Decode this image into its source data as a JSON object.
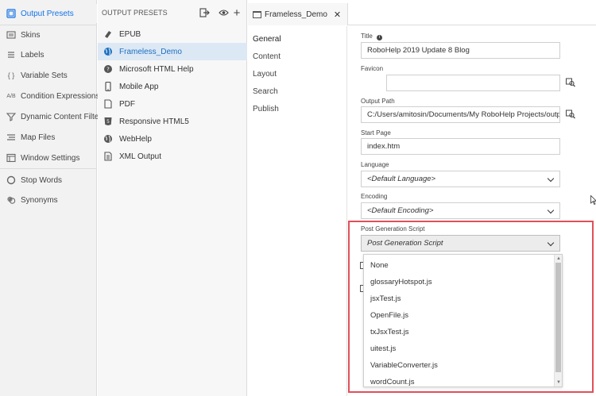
{
  "left_nav": {
    "items": [
      {
        "label": "Output Presets",
        "icon": "output-presets-icon",
        "active": true
      },
      {
        "label": "Skins",
        "icon": "skins-icon"
      },
      {
        "label": "Labels",
        "icon": "labels-icon"
      },
      {
        "label": "Variable Sets",
        "icon": "variable-sets-icon",
        "glyph": "{ }"
      },
      {
        "label": "Condition Expressions",
        "icon": "condition-expressions-icon",
        "glyph": "A/B"
      },
      {
        "label": "Dynamic Content Filters",
        "icon": "filter-icon"
      },
      {
        "label": "Map Files",
        "icon": "map-files-icon"
      },
      {
        "label": "Window Settings",
        "icon": "window-settings-icon"
      },
      {
        "label": "Stop Words",
        "icon": "stop-words-icon"
      },
      {
        "label": "Synonyms",
        "icon": "synonyms-icon"
      }
    ]
  },
  "presets": {
    "header": "OUTPUT PRESETS",
    "items": [
      {
        "label": "EPUB",
        "icon": "epub-icon"
      },
      {
        "label": "Frameless_Demo",
        "icon": "globe-icon",
        "selected": true
      },
      {
        "label": "Microsoft HTML Help",
        "icon": "html-help-icon"
      },
      {
        "label": "Mobile App",
        "icon": "mobile-icon"
      },
      {
        "label": "PDF",
        "icon": "pdf-icon"
      },
      {
        "label": "Responsive HTML5",
        "icon": "html5-icon"
      },
      {
        "label": "WebHelp",
        "icon": "globe-icon"
      },
      {
        "label": "XML Output",
        "icon": "xml-icon"
      }
    ]
  },
  "editor": {
    "tab_label": "Frameless_Demo",
    "nav": [
      "General",
      "Content",
      "Layout",
      "Search",
      "Publish"
    ],
    "form": {
      "title_label": "Title",
      "title_value": "RoboHelp 2019 Update 8 Blog",
      "favicon_label": "Favicon",
      "favicon_value": "",
      "output_path_label": "Output Path",
      "output_path_value": "C:/Users/amitosin/Documents/My RoboHelp Projects/output...",
      "start_page_label": "Start Page",
      "start_page_value": "index.htm",
      "language_label": "Language",
      "language_value": "<Default Language>",
      "encoding_label": "Encoding",
      "encoding_value": "<Default Encoding>",
      "post_gen_label": "Post Generation Script",
      "post_gen_value": "Post Generation Script"
    },
    "post_gen_options": [
      "None",
      "glossaryHotspot.js",
      "jsxTest.js",
      "OpenFile.js",
      "txJsxTest.js",
      "uitest.js",
      "VariableConverter.js",
      "wordCount.js"
    ]
  },
  "colors": {
    "accent": "#1473e6",
    "highlight": "#e0505a",
    "selected_bg": "#dde8f5"
  }
}
